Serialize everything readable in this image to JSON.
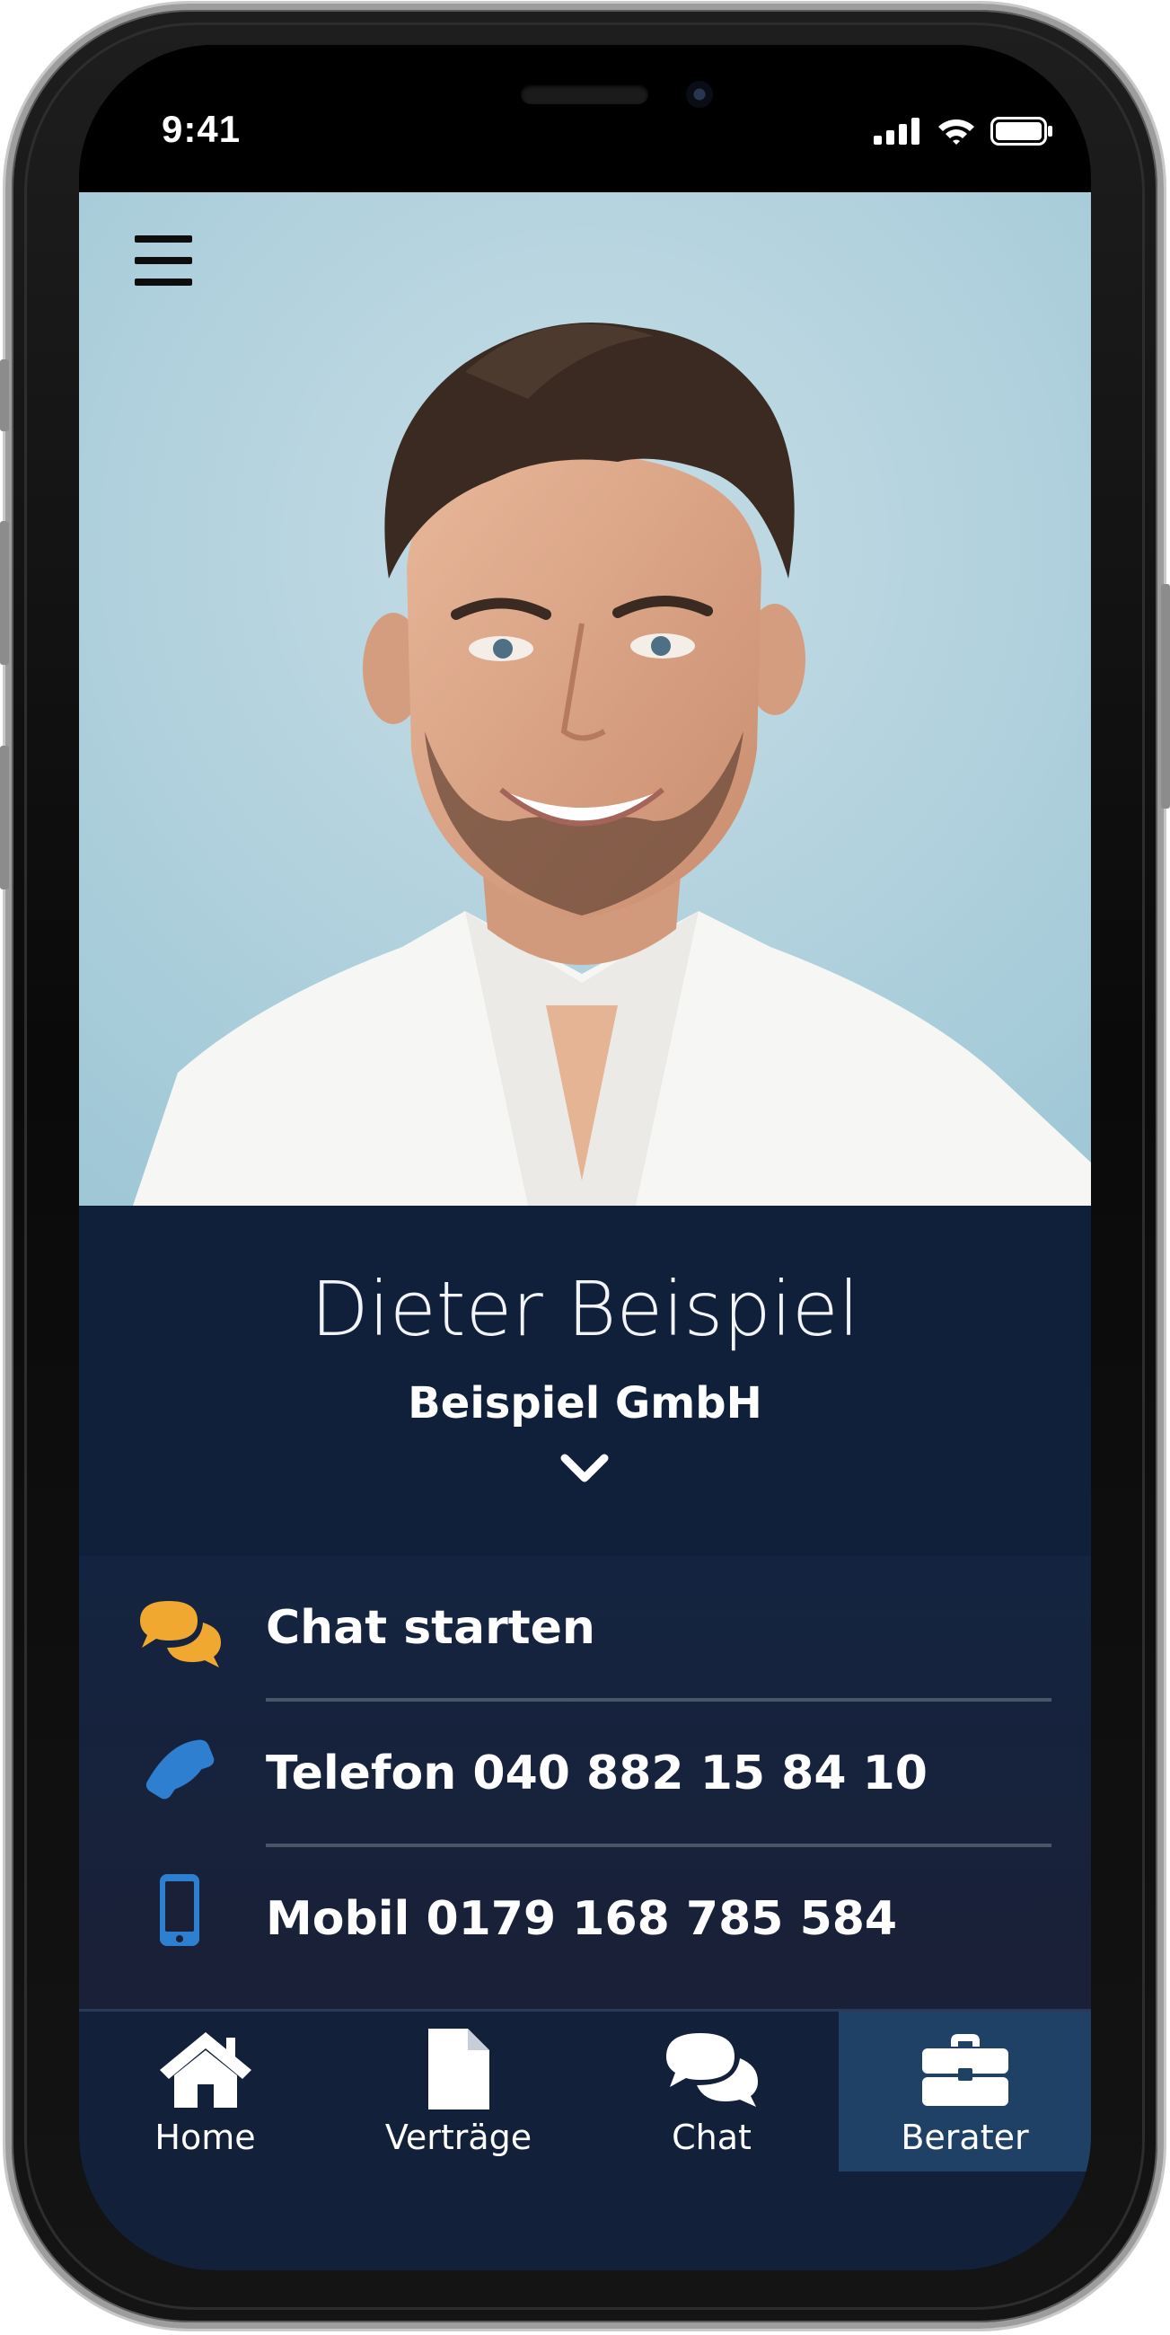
{
  "status_bar": {
    "time": "9:41",
    "icons": [
      "signal-icon",
      "wifi-icon",
      "battery-icon"
    ]
  },
  "header": {
    "menu_icon": "hamburger-menu-icon"
  },
  "adviser": {
    "name": "Dieter Beispiel",
    "company": "Beispiel GmbH",
    "expand_icon": "chevron-down-icon"
  },
  "contacts": [
    {
      "icon": "chat-bubbles-icon",
      "label": "Chat starten",
      "color": "#f0a830"
    },
    {
      "icon": "phone-icon",
      "label": "Telefon 040 882 15 84 10",
      "color": "#2f7fd0"
    },
    {
      "icon": "mobile-icon",
      "label": "Mobil 0179 168 785 584",
      "color": "#2f7fd0"
    }
  ],
  "tabs": [
    {
      "icon": "home-icon",
      "label": "Home",
      "active": false
    },
    {
      "icon": "document-icon",
      "label": "Verträge",
      "active": false
    },
    {
      "icon": "chat-bubbles-icon",
      "label": "Chat",
      "active": false
    },
    {
      "icon": "briefcase-icon",
      "label": "Berater",
      "active": true
    }
  ],
  "colors": {
    "panel": "#11203a",
    "active_tab": "#1f4166",
    "accent_orange": "#f0a830",
    "accent_blue": "#2f7fd0"
  }
}
